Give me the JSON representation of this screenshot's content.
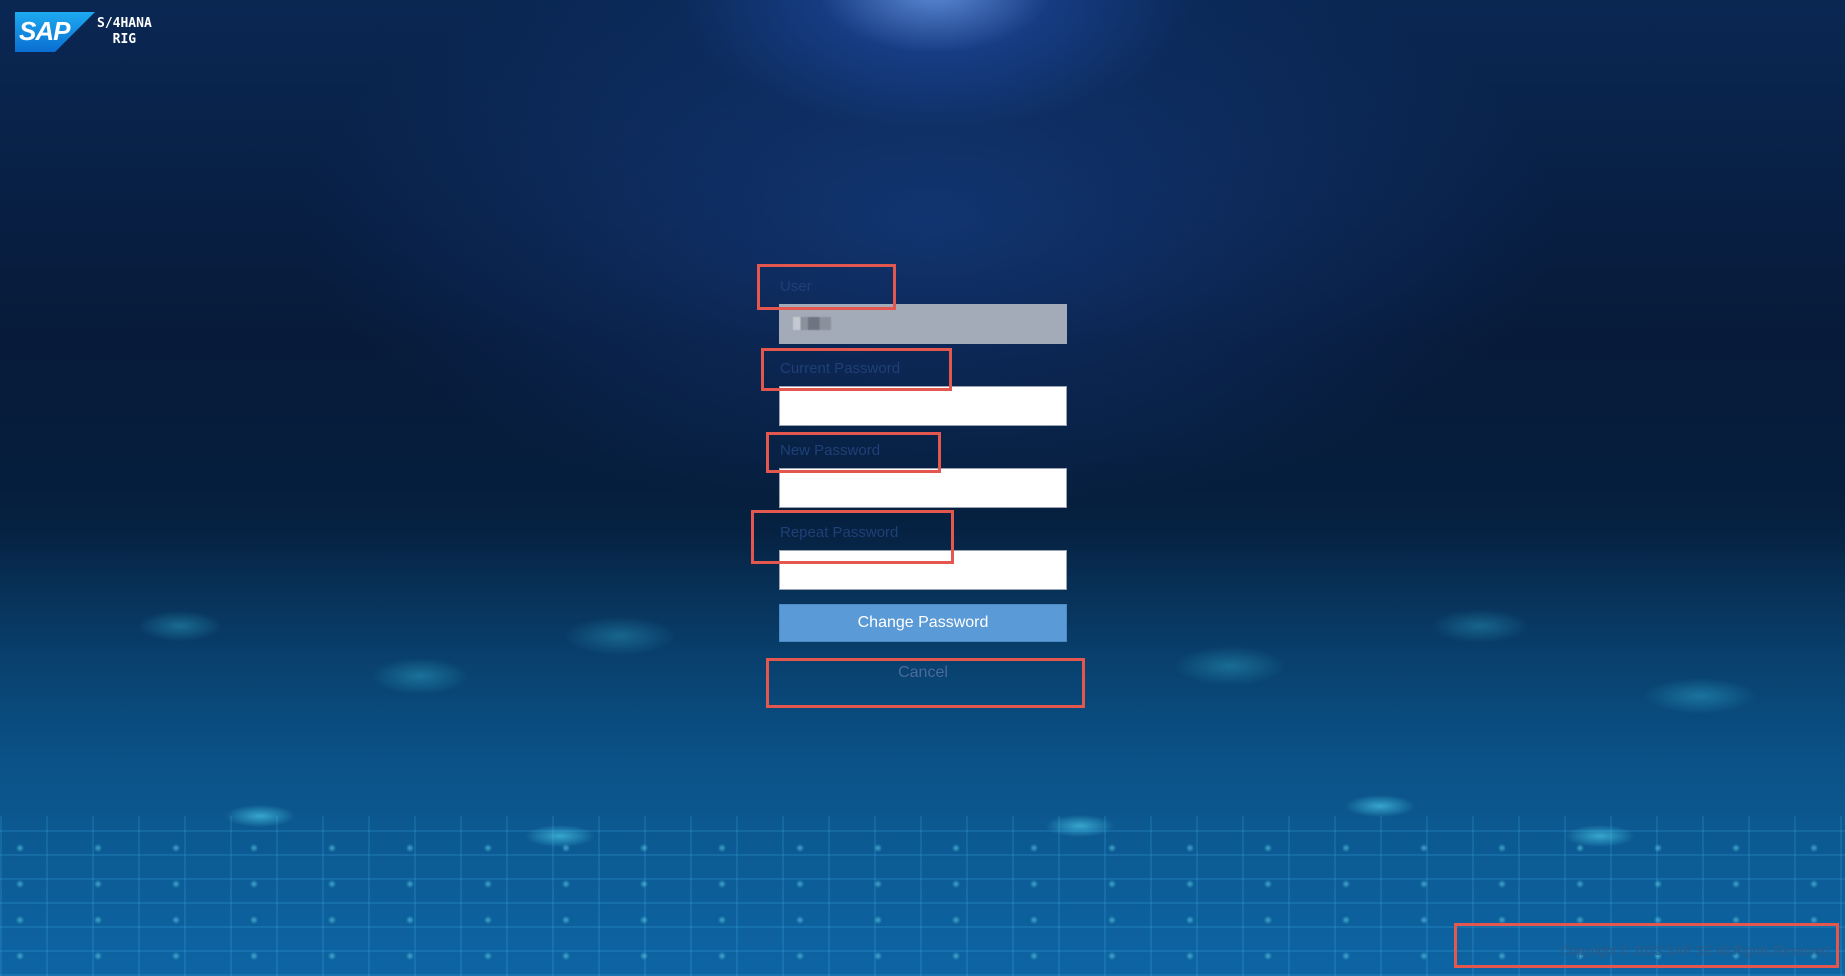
{
  "logo": {
    "brand": "SAP",
    "product_line1": "S/4HANA",
    "product_line2": "RIG"
  },
  "form": {
    "user_label": "User",
    "user_value": "",
    "current_password_label": "Current Password",
    "new_password_label": "New Password",
    "repeat_password_label": "Repeat Password",
    "change_password_button": "Change Password",
    "cancel_button": "Cancel"
  },
  "footer": {
    "copyright": "Copyright © 2023 SAP SE All Rights Reserved."
  },
  "colors": {
    "primary_button": "#5a9ad6",
    "annotation_box": "#e4574f",
    "brand_blue": "#0a6ed1"
  }
}
